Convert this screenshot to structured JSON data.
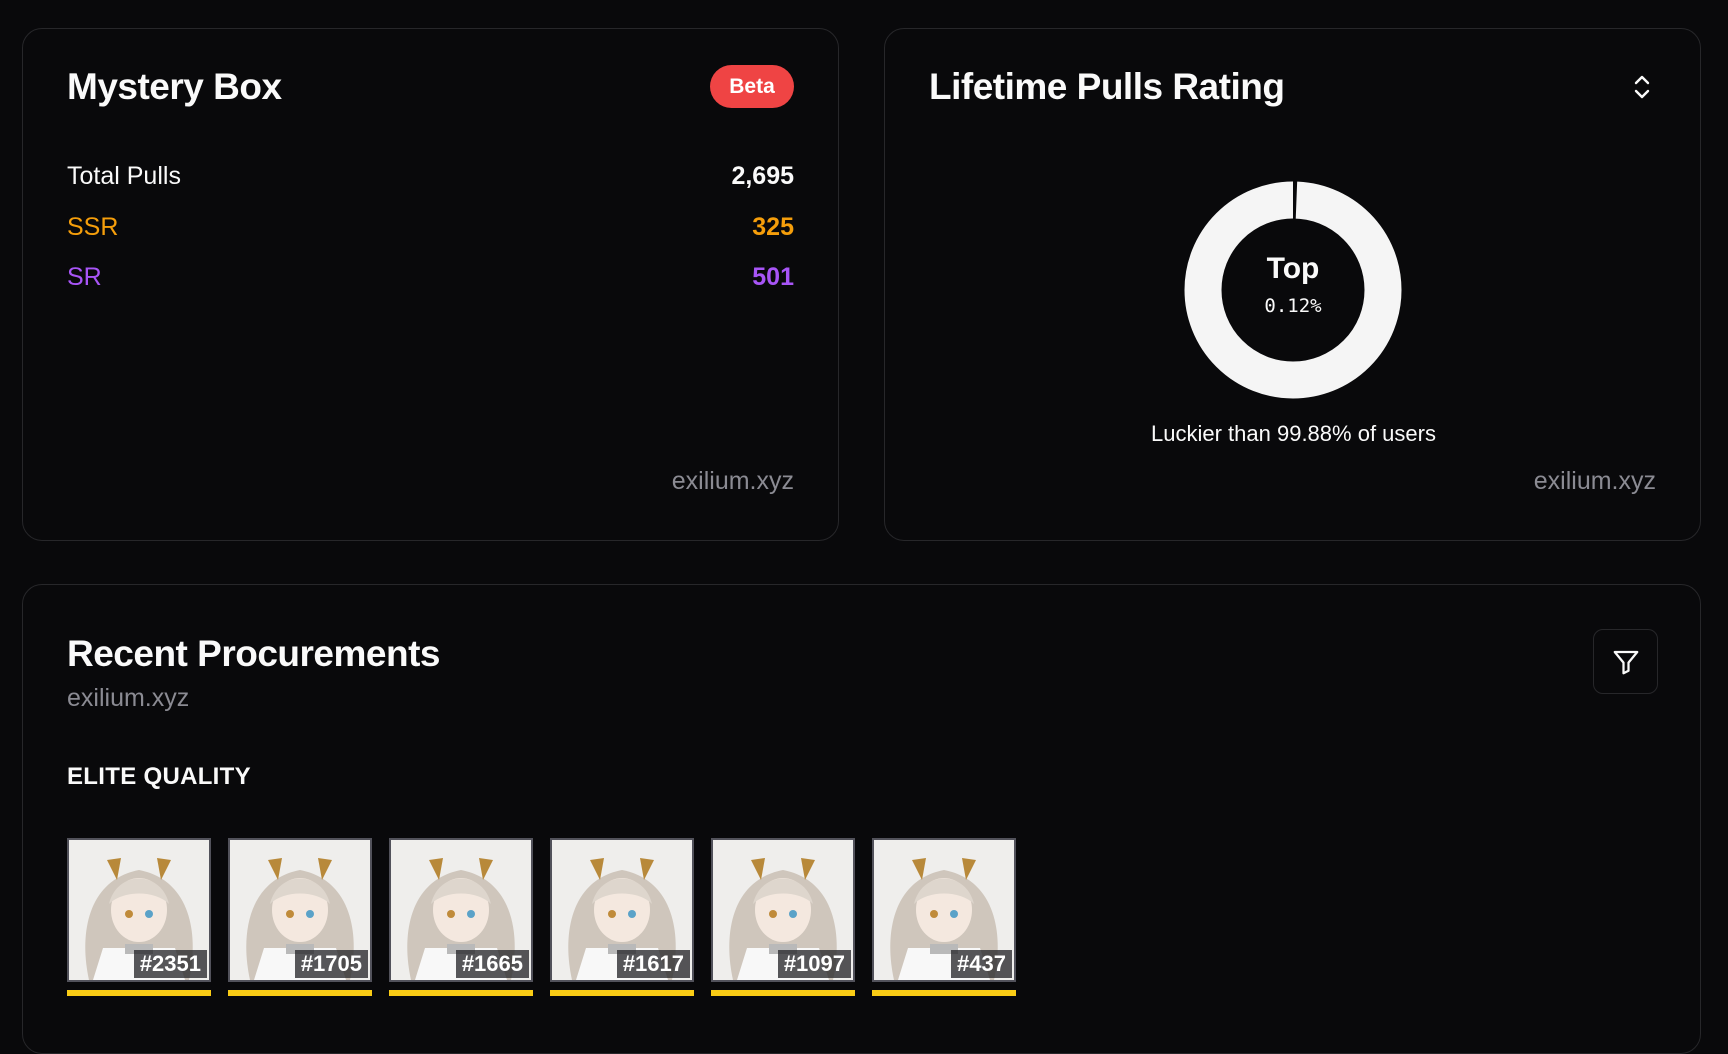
{
  "mystery_box": {
    "title": "Mystery Box",
    "badge": "Beta",
    "stats": [
      {
        "label": "Total Pulls",
        "value": "2,695",
        "color": "#fafafa"
      },
      {
        "label": "SSR",
        "value": "325",
        "color": "#f59e0b"
      },
      {
        "label": "SR",
        "value": "501",
        "color": "#a855f7"
      }
    ],
    "watermark": "exilium.xyz"
  },
  "rating": {
    "title": "Lifetime Pulls Rating",
    "sort_icon": "chevron-up-down-icon",
    "top_label": "Top",
    "top_percent": "0.12%",
    "top_fraction": 0.0012,
    "luck_text": "Luckier than 99.88% of users",
    "watermark": "exilium.xyz"
  },
  "recent": {
    "title": "Recent Procurements",
    "subtitle": "exilium.xyz",
    "filter_icon": "filter-icon",
    "section_label": "ELITE QUALITY",
    "quality_color": "#facc15",
    "items": [
      {
        "tag": "#2351"
      },
      {
        "tag": "#1705"
      },
      {
        "tag": "#1665"
      },
      {
        "tag": "#1617"
      },
      {
        "tag": "#1097"
      },
      {
        "tag": "#437"
      }
    ]
  },
  "colors": {
    "background": "#09090b",
    "card_border": "#27272a",
    "badge": "#ef4444",
    "ssr": "#f59e0b",
    "sr": "#a855f7"
  }
}
